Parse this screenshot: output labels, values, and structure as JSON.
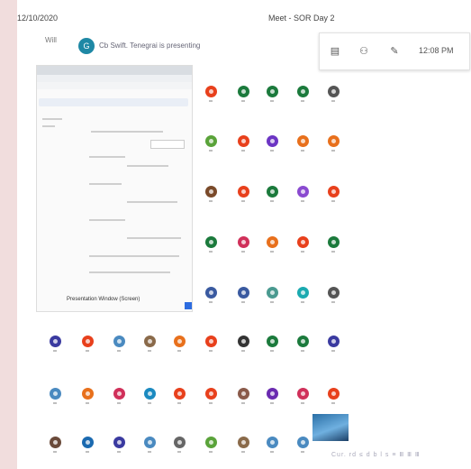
{
  "header": {
    "date": "12/10/2020",
    "meeting_title": "Meet - SOR Day 2"
  },
  "toolbar": {
    "time": "12:08 PM",
    "icons": [
      "document-icon",
      "people-icon",
      "chat-icon"
    ]
  },
  "presenting": {
    "prefix": "Will",
    "avatar_letter": "G",
    "text": "Cb Swift. Tenegrai is presenting"
  },
  "shared_screen": {
    "caption": "Presentation Window (Screen)"
  },
  "participant_colors": [
    "#e8401c",
    "#1b7a3c",
    "#1b7a3c",
    "#1b7a3c",
    "#555555",
    "#5aa33a",
    "#e8401c",
    "#6c35c4",
    "#e8701c",
    "#e8701c",
    "#7a4a2a",
    "#e8401c",
    "#1b7a3c",
    "#8a4ad0",
    "#e8401c",
    "#1b7a3c",
    "#d0305a",
    "#e8701c",
    "#e8401c",
    "#1b7a3c",
    "#3a5aa0",
    "#3a5aa0",
    "#4a9a90",
    "#1baab0",
    "#555555",
    "#3a3aa0",
    "#e8401c",
    "#4a8ac0",
    "#8a6a4a",
    "#e8701c",
    "#e8401c",
    "#333333",
    "#1b7a3c",
    "#1b7a3c",
    "#3a3aa0",
    "#4a8ac0",
    "#e8701c",
    "#d0305a",
    "#1b8ac0",
    "#e8401c",
    "#e8401c",
    "#8a5a4a",
    "#6a2ab0",
    "#d0305a",
    "#e8401c",
    "#6a4a3a",
    "#1b6ab0",
    "#3a3aa0",
    "#4a8ac0",
    "#666666",
    "#5aa33a",
    "#8a6a4a",
    "#4a8ac0",
    "#4a8ac0"
  ],
  "footer": {
    "text": "Cur. rd ≤ d b l s ≡ Ⅲ Ⅲ Ⅲ"
  }
}
